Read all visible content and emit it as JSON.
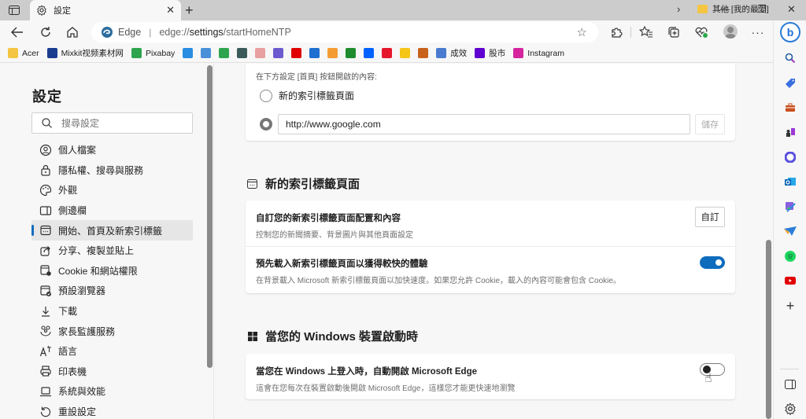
{
  "browser": {
    "tab": {
      "title": "設定",
      "icon": "gear-icon"
    },
    "new_tab_label": "+",
    "window_controls": {
      "minimize": "—",
      "maximize": "❐",
      "close": "✕"
    },
    "address": {
      "site_label": "Edge",
      "url_prefix": "edge://",
      "url_bold": "settings",
      "url_rest": "/startHomeNTP"
    },
    "toolbar_icons": [
      "back-icon",
      "refresh-icon",
      "home-icon",
      "favorite-star-icon",
      "extensions-icon",
      "favorites-icon",
      "collections-icon",
      "browser-essentials-icon",
      "profile-avatar",
      "more-icon",
      "bing-copilot-icon"
    ]
  },
  "bookmarks": {
    "items": [
      {
        "label": "Acer",
        "icon": "folder-icon",
        "color": "#f4c542"
      },
      {
        "label": "Mixkit视频素材网",
        "icon": "mixkit-icon",
        "color": "#1a3d8f"
      },
      {
        "label": "Pixabay",
        "icon": "pixabay-icon",
        "color": "#2ea44f"
      },
      {
        "label": "",
        "icon": "telegram-bookmark-icon",
        "color": "#2a8de0"
      },
      {
        "label": "",
        "icon": "map-bookmark-icon",
        "color": "#4a90d9"
      },
      {
        "label": "",
        "icon": "green-app-icon",
        "color": "#2ea44f"
      },
      {
        "label": "",
        "icon": "monitor-icon",
        "color": "#3b5a5a"
      },
      {
        "label": "",
        "icon": "gift-icon",
        "color": "#e8a0a0"
      },
      {
        "label": "",
        "icon": "puzzle-app-icon",
        "color": "#6a5acd"
      },
      {
        "label": "",
        "icon": "youtube-icon",
        "color": "#e00000"
      },
      {
        "label": "",
        "icon": "globe-c-icon",
        "color": "#1f6fd0"
      },
      {
        "label": "",
        "icon": "blogger-icon",
        "color": "#f39c32"
      },
      {
        "label": "",
        "icon": "dot-icon",
        "color": "#1e8c2e"
      },
      {
        "label": "",
        "icon": "dropbox-icon",
        "color": "#0061fe"
      },
      {
        "label": "",
        "icon": "weibo-icon",
        "color": "#e6162d"
      },
      {
        "label": "",
        "icon": "star-face-icon",
        "color": "#f5c518"
      },
      {
        "label": "",
        "icon": "c-brand-icon",
        "color": "#c8621b"
      },
      {
        "label": "成效",
        "icon": "funnel-icon",
        "color": "#4a7bd0"
      },
      {
        "label": "股市",
        "icon": "yahoo-icon",
        "color": "#5f01d1"
      },
      {
        "label": "Instagram",
        "icon": "instagram-icon",
        "color": "#d6249f"
      }
    ],
    "more_label": "›",
    "other_favorites": "其他 [我的最愛]"
  },
  "settings_nav": {
    "title": "設定",
    "search_placeholder": "搜尋設定",
    "items": [
      {
        "label": "個人檔案",
        "icon": "profile-icon",
        "active": false
      },
      {
        "label": "隱私權、搜尋與服務",
        "icon": "lock-icon",
        "active": false
      },
      {
        "label": "外觀",
        "icon": "palette-icon",
        "active": false
      },
      {
        "label": "側邊欄",
        "icon": "sidebar-icon",
        "active": false
      },
      {
        "label": "開始、首頁及新索引標籤",
        "icon": "start-home-icon",
        "active": true
      },
      {
        "label": "分享、複製並貼上",
        "icon": "share-icon",
        "active": false
      },
      {
        "label": "Cookie 和網站權限",
        "icon": "cookie-permissions-icon",
        "active": false
      },
      {
        "label": "預設瀏覽器",
        "icon": "default-browser-icon",
        "active": false
      },
      {
        "label": "下載",
        "icon": "download-icon",
        "active": false
      },
      {
        "label": "家長監護服務",
        "icon": "family-icon",
        "active": false
      },
      {
        "label": "語言",
        "icon": "language-icon",
        "active": false
      },
      {
        "label": "印表機",
        "icon": "printer-icon",
        "active": false
      },
      {
        "label": "系統與效能",
        "icon": "laptop-icon",
        "active": false
      },
      {
        "label": "重設設定",
        "icon": "reset-icon",
        "active": false
      }
    ]
  },
  "main": {
    "home_card": {
      "hint": "在下方設定 [首頁] 按鈕開啟的內容:",
      "option_new_tab": "新的索引標籤頁面",
      "url_value": "http://www.google.com",
      "selected_option": "url",
      "save_label": "儲存"
    },
    "ntp_section": {
      "title": "新的索引標籤頁面",
      "rows": [
        {
          "title": "自訂您的新索引標籤頁面配置和內容",
          "desc": "控制您的新聞摘要、背景圖片與其他頁面設定",
          "button": "自訂"
        },
        {
          "title": "預先載入新索引標籤頁面以獲得較快的體驗",
          "desc": "在背景載入 Microsoft 新索引標籤頁面以加快速度。如果您允許 Cookie，載入的內容可能會包含 Cookie。",
          "toggle": true
        }
      ]
    },
    "startup_section": {
      "title": "當您的 Windows 裝置啟動時",
      "rows": [
        {
          "title": "當您在 Windows 上登入時，自動開啟 Microsoft Edge",
          "desc": "這會在您每次在裝置啟動後開啟 Microsoft Edge，這樣您才能更快速地瀏覽",
          "toggle": false
        }
      ]
    }
  },
  "edge_sidebar": {
    "items": [
      "search-icon",
      "shopping-tag-icon",
      "tools-icon",
      "games-icon",
      "microsoft365-icon",
      "outlook-icon",
      "designer-icon",
      "send-icon",
      "spotify-icon",
      "youtube-icon",
      "add-icon"
    ],
    "bottom": [
      "hide-sidebar-icon",
      "sidebar-settings-icon"
    ]
  },
  "colors": {
    "accent": "#0f6cbd"
  }
}
